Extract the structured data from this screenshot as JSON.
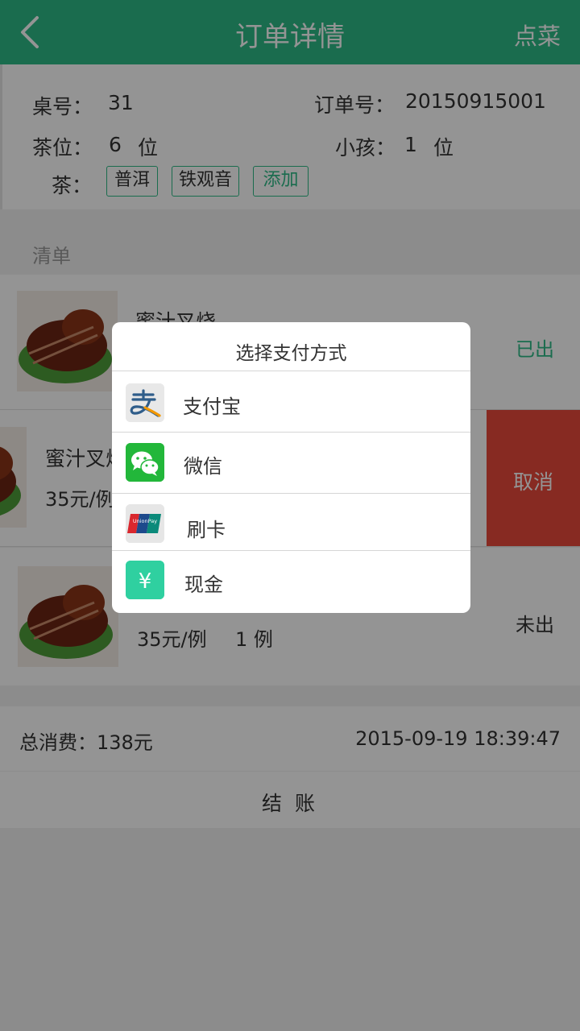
{
  "header": {
    "title": "订单详情",
    "action": "点菜"
  },
  "info": {
    "table_label": "桌号：",
    "table_value": "31",
    "order_label": "订单号：",
    "order_value": "20150915001",
    "seats_label": "茶位：",
    "seats_value": "6",
    "seats_unit": "位",
    "kids_label": "小孩：",
    "kids_value": "1",
    "kids_unit": "位",
    "tea_label": "茶：",
    "teas": [
      "普洱",
      "铁观音"
    ],
    "add_tea": "添加"
  },
  "list": {
    "section_label": "清单",
    "items": [
      {
        "name": "蜜汁叉烧",
        "status": "已出"
      },
      {
        "name": "蜜汁叉烧",
        "price": "35元/例",
        "cancel": "取消"
      },
      {
        "price": "35元/例",
        "qty": "1 例",
        "status": "未出"
      }
    ]
  },
  "summary": {
    "total": "总消费：138元",
    "time": "2015-09-19 18:39:47",
    "checkout": "结 账"
  },
  "dialog": {
    "title": "选择支付方式",
    "options": [
      "支付宝",
      "微信",
      "刷卡",
      "现金"
    ]
  },
  "colors": {
    "primary": "#2dbb87",
    "danger": "#e8493b",
    "overlay": "rgba(0,0,0,0.42)"
  }
}
